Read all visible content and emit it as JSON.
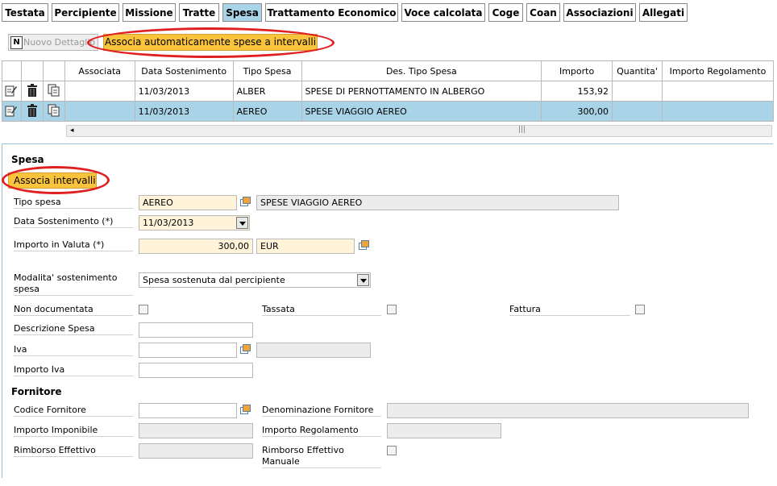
{
  "tabs": [
    {
      "label": "Testata",
      "active": false
    },
    {
      "label": "Percipiente",
      "active": false
    },
    {
      "label": "Missione",
      "active": false
    },
    {
      "label": "Tratte",
      "active": false
    },
    {
      "label": "Spesa",
      "active": true
    },
    {
      "label": "Trattamento Economico",
      "active": false
    },
    {
      "label": "Voce calcolata",
      "active": false
    },
    {
      "label": "Coge",
      "active": false
    },
    {
      "label": "Coan",
      "active": false
    },
    {
      "label": "Associazioni",
      "active": false
    },
    {
      "label": "Allegati",
      "active": false
    }
  ],
  "toolbar": {
    "new_detail_label": "Nuovo Dettaglio",
    "auto_associate_label": "Associa automaticamente spese a intervalli"
  },
  "grid": {
    "headers": [
      "Associata",
      "Data Sostenimento",
      "Tipo Spesa",
      "Des. Tipo Spesa",
      "Importo",
      "Quantita'",
      "Importo Regolamento"
    ],
    "rows": [
      {
        "associata": "",
        "data": "11/03/2013",
        "tipo": "ALBER",
        "descrizione": "SPESE DI PERNOTTAMENTO IN ALBERGO",
        "importo": "153,92",
        "quantita": "",
        "importo_regolamento": "",
        "selected": false
      },
      {
        "associata": "",
        "data": "11/03/2013",
        "tipo": "AEREO",
        "descrizione": "SPESE VIAGGIO AEREO",
        "importo": "300,00",
        "quantita": "",
        "importo_regolamento": "",
        "selected": true
      }
    ]
  },
  "form": {
    "section_title": "Spesa",
    "associa_intervalli_label": "Associa intervalli",
    "tipo_spesa_label": "Tipo spesa",
    "tipo_spesa_code": "AEREO",
    "tipo_spesa_desc": "SPESE VIAGGIO AEREO",
    "data_sostenimento_label": "Data Sostenimento (*)",
    "data_sostenimento_value": "11/03/2013",
    "importo_valuta_label": "Importo in Valuta (*)",
    "importo_valuta_value": "300,00",
    "valuta": "EUR",
    "modalita_label": "Modalita' sostenimento spesa",
    "modalita_value": "Spesa sostenuta dal percipiente",
    "non_documentata_label": "Non documentata",
    "tassata_label": "Tassata",
    "fattura_label": "Fattura",
    "descrizione_spesa_label": "Descrizione Spesa",
    "iva_label": "Iva",
    "importo_iva_label": "Importo Iva",
    "fornitore_title": "Fornitore",
    "codice_fornitore_label": "Codice Fornitore",
    "denominazione_fornitore_label": "Denominazione Fornitore",
    "importo_imponibile_label": "Importo Imponibile",
    "importo_regolamento_label": "Importo Regolamento",
    "rimborso_effettivo_label": "Rimborso Effettivo",
    "rimborso_effettivo_manuale_label": "Rimborso Effettivo Manuale"
  },
  "colors": {
    "accent_blue": "#a9d3e6",
    "button_orange": "#f9c33b",
    "highlight_red": "#e02020"
  }
}
